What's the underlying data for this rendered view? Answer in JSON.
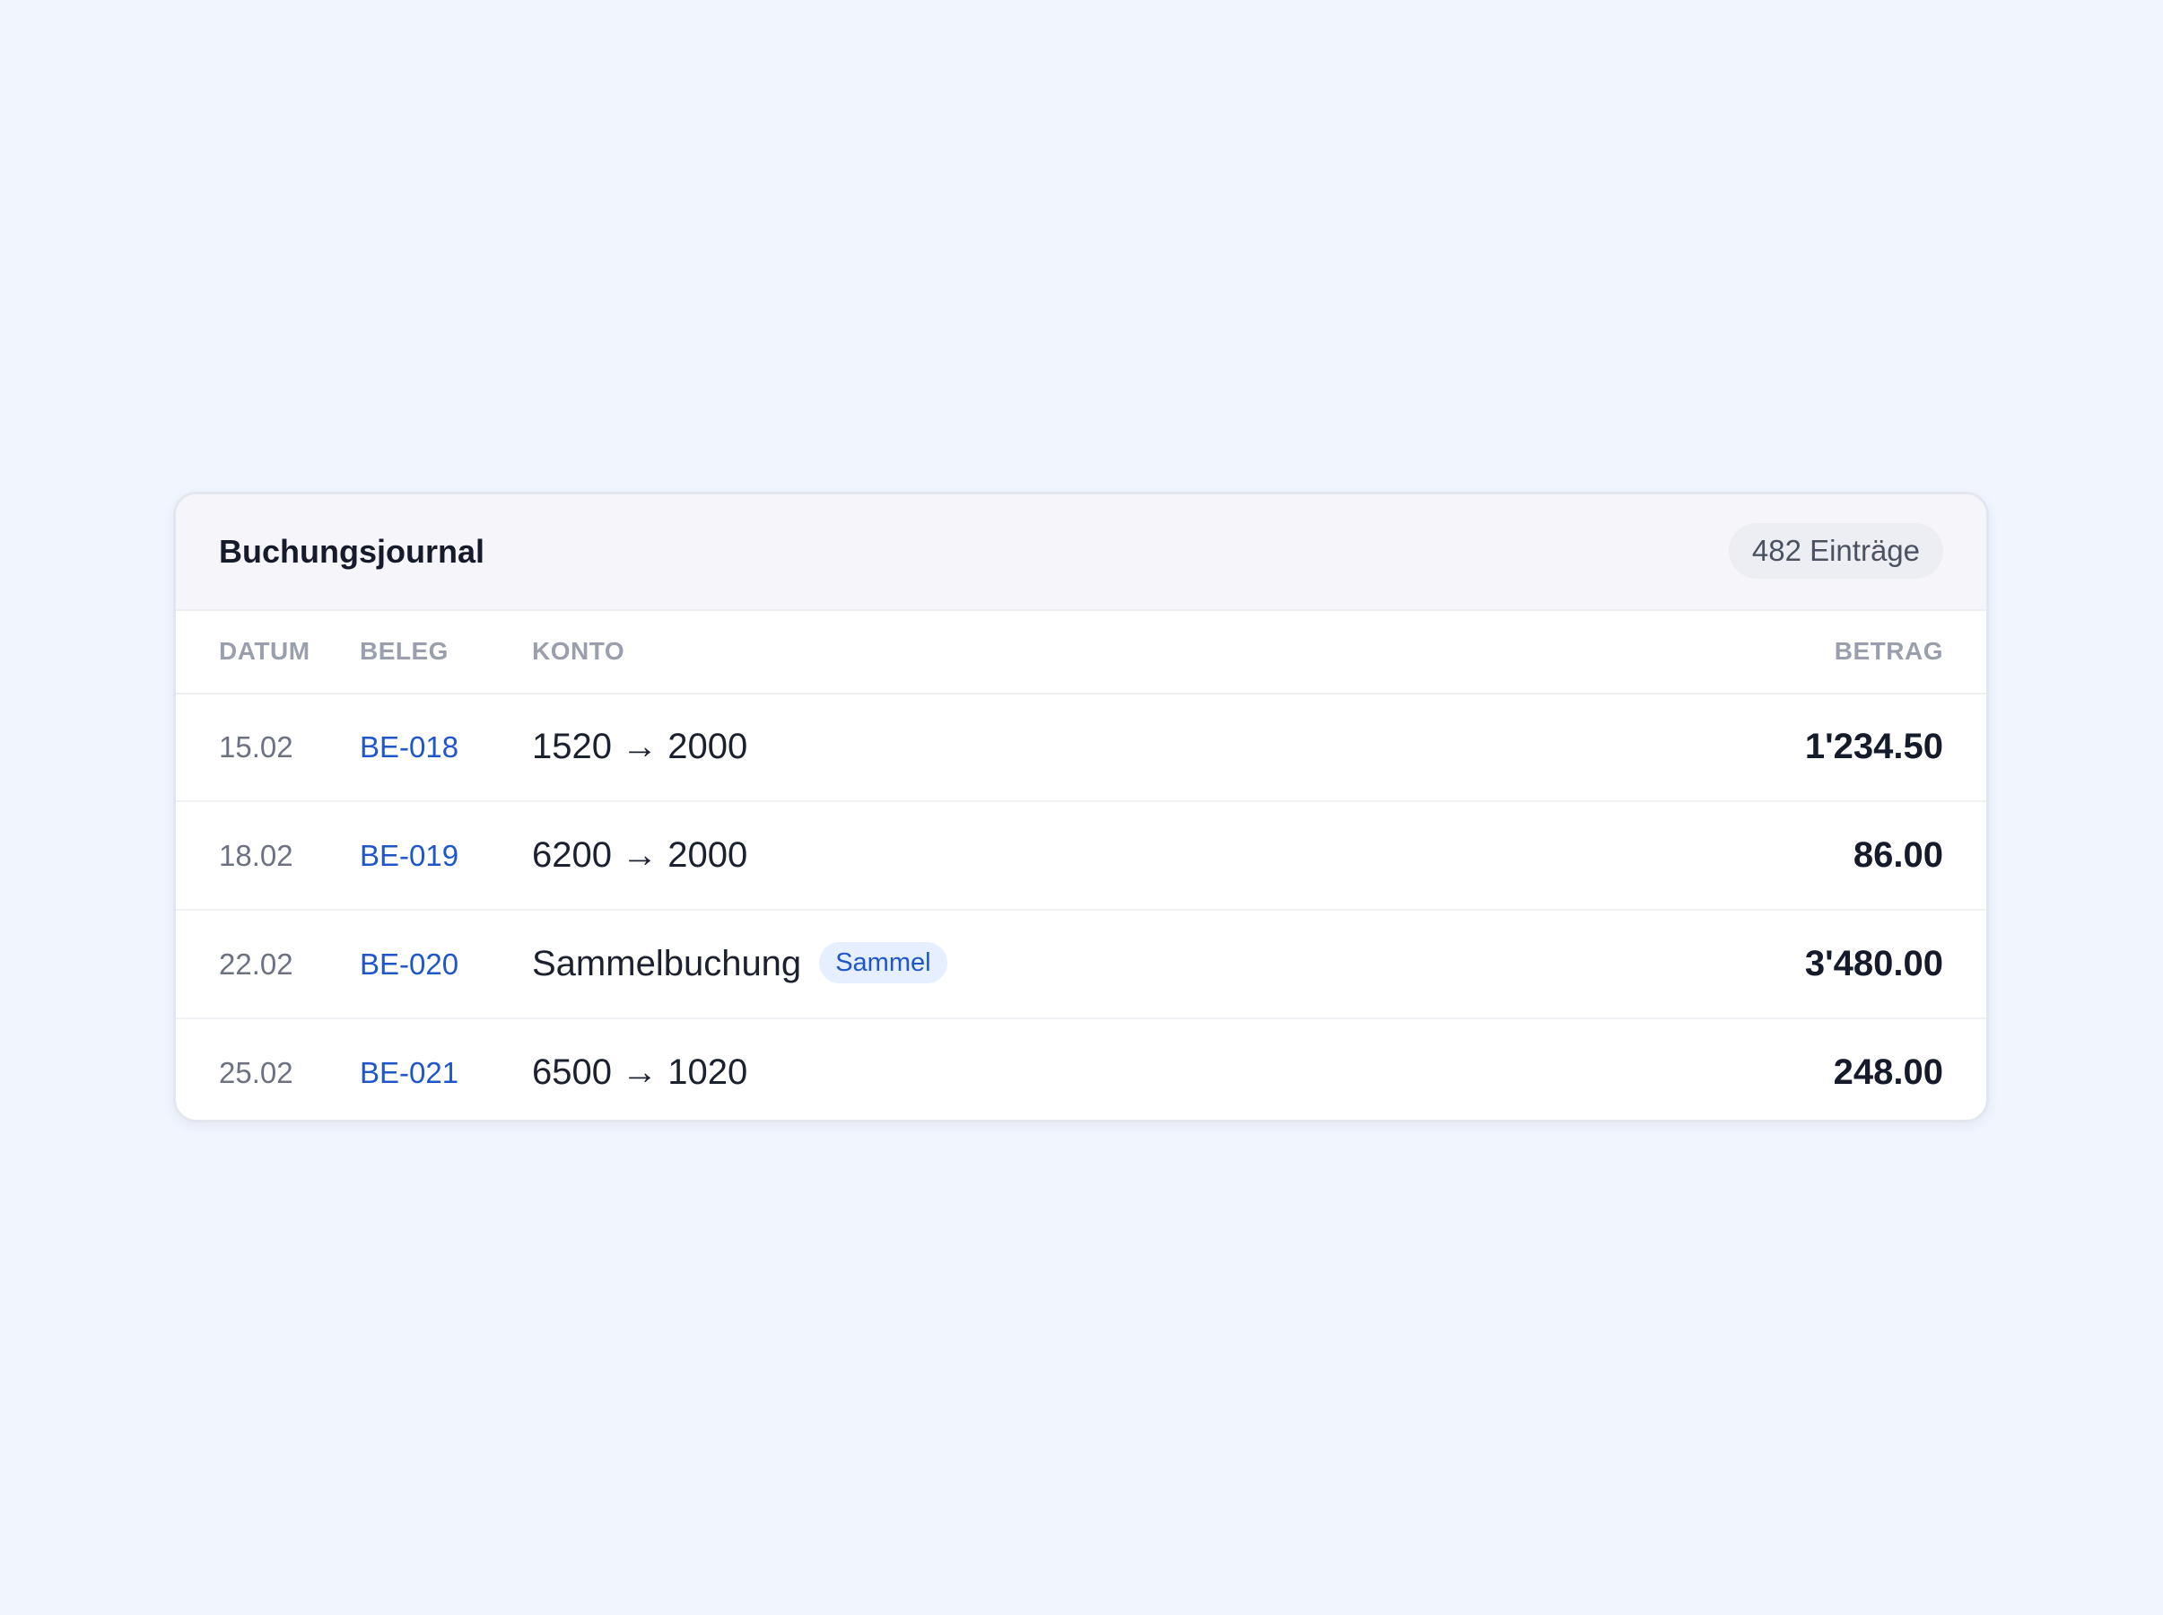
{
  "journal": {
    "title": "Buchungsjournal",
    "entry_count": "482 Einträge",
    "columns": {
      "date": "DATUM",
      "ref": "BELEG",
      "account": "KONTO",
      "amount": "BETRAG"
    },
    "rows": [
      {
        "date": "15.02",
        "ref": "BE-018",
        "account": "1520 → 2000",
        "tag": "",
        "amount": "1'234.50"
      },
      {
        "date": "18.02",
        "ref": "BE-019",
        "account": "6200 → 2000",
        "tag": "",
        "amount": "86.00"
      },
      {
        "date": "22.02",
        "ref": "BE-020",
        "account": "Sammelbuchung",
        "tag": "Sammel",
        "amount": "3'480.00"
      },
      {
        "date": "25.02",
        "ref": "BE-021",
        "account": "6500 → 1020",
        "tag": "",
        "amount": "248.00"
      }
    ]
  },
  "colors": {
    "background": "#f0f5fe",
    "card": "#ffffff",
    "header": "#f6f5fa",
    "link": "#1f56c9",
    "tag_bg": "#e6efff",
    "text_primary": "#161b2b",
    "text_muted": "#9a9fae"
  }
}
